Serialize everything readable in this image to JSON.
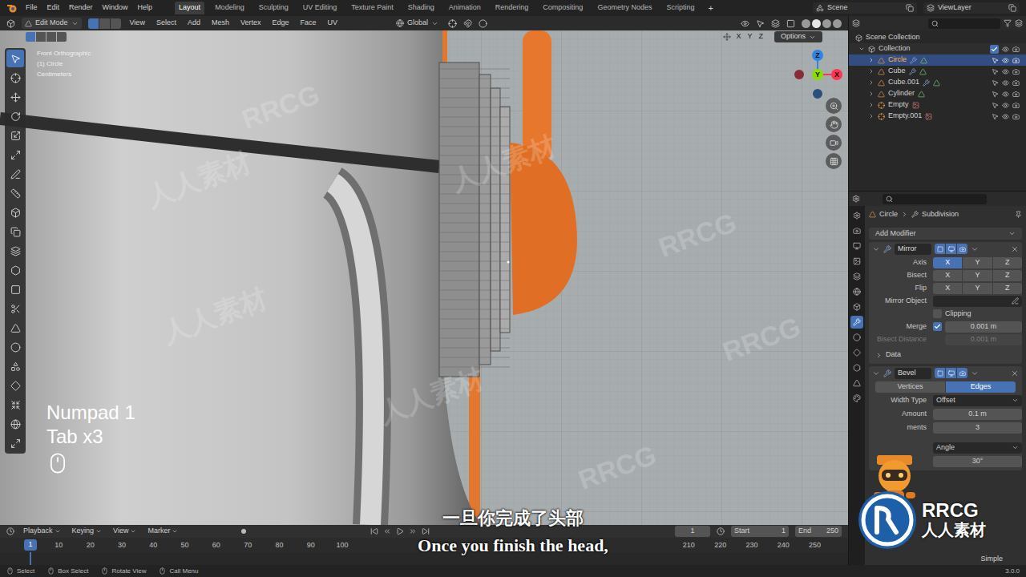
{
  "top_bar": {
    "menus": [
      "File",
      "Edit",
      "Render",
      "Window",
      "Help"
    ],
    "workspaces": [
      {
        "label": "Layout",
        "selected": true
      },
      {
        "label": "Modeling",
        "selected": false
      },
      {
        "label": "Sculpting",
        "selected": false
      },
      {
        "label": "UV Editing",
        "selected": false
      },
      {
        "label": "Texture Paint",
        "selected": false
      },
      {
        "label": "Shading",
        "selected": false
      },
      {
        "label": "Animation",
        "selected": false
      },
      {
        "label": "Rendering",
        "selected": false
      },
      {
        "label": "Compositing",
        "selected": false
      },
      {
        "label": "Geometry Nodes",
        "selected": false
      },
      {
        "label": "Scripting",
        "selected": false
      }
    ],
    "add_workspace": "+",
    "scene": "Scene",
    "view_layer": "ViewLayer"
  },
  "viewport_header": {
    "mode": "Edit Mode",
    "menus": [
      "View",
      "Select",
      "Add",
      "Mesh",
      "Vertex",
      "Edge",
      "Face",
      "UV"
    ],
    "orientation": "Global",
    "axes": [
      "X",
      "Y",
      "Z"
    ],
    "options": "Options"
  },
  "viewport": {
    "view": "Front Orthographic",
    "object": "(1) Circle",
    "units": "Centimeters",
    "keys": [
      "Numpad 1",
      "Tab x3"
    ],
    "gizmo": [
      {
        "label": "Z",
        "color": "#2f83e3"
      },
      {
        "label": "Y",
        "color": "#8bdc00"
      },
      {
        "label": "X",
        "color": "#ff3352"
      }
    ]
  },
  "watermarks": [
    "RRCG",
    "人人素材"
  ],
  "outliner": {
    "root": "Scene Collection",
    "collection": "Collection",
    "collection_checked": true,
    "items": [
      {
        "name": "Circle",
        "selected": true,
        "kind": "mesh",
        "modified": true
      },
      {
        "name": "Cube",
        "selected": false,
        "kind": "mesh",
        "modified": true
      },
      {
        "name": "Cube.001",
        "selected": false,
        "kind": "mesh",
        "modified": true
      },
      {
        "name": "Cylinder",
        "selected": false,
        "kind": "mesh",
        "modified": false
      },
      {
        "name": "Empty",
        "selected": false,
        "kind": "empty",
        "modified": false
      },
      {
        "name": "Empty.001",
        "selected": false,
        "kind": "empty",
        "modified": false
      }
    ]
  },
  "properties": {
    "breadcrumb": [
      "Circle",
      "Subdivision"
    ],
    "add_modifier": "Add Modifier",
    "mirror": {
      "name": "Mirror",
      "toggle_rows": [
        {
          "label": "Axis",
          "buttons": [
            {
              "label": "X",
              "selected": true
            },
            {
              "label": "Y",
              "selected": false
            },
            {
              "label": "Z",
              "selected": false
            }
          ]
        },
        {
          "label": "Bisect",
          "buttons": [
            {
              "label": "X",
              "selected": false
            },
            {
              "label": "Y",
              "selected": false
            },
            {
              "label": "Z",
              "selected": false
            }
          ]
        },
        {
          "label": "Flip",
          "buttons": [
            {
              "label": "X",
              "selected": false
            },
            {
              "label": "Y",
              "selected": false
            },
            {
              "label": "Z",
              "selected": false
            }
          ]
        }
      ],
      "mirror_object_label": "Mirror Object",
      "clipping": {
        "label": "Clipping",
        "checked": false
      },
      "merge": {
        "label": "Merge",
        "checked": true,
        "value": "0.001 m"
      },
      "bisect_distance": {
        "label": "Bisect Distance",
        "value": "0.001 m",
        "disabled": true
      },
      "data": "Data"
    },
    "bevel": {
      "name": "Bevel",
      "tabs": [
        {
          "label": "Vertices",
          "selected": false
        },
        {
          "label": "Edges",
          "selected": true
        }
      ],
      "rows": [
        {
          "label": "Width Type",
          "value": "Offset",
          "kind": "dropdown"
        },
        {
          "label": "Amount",
          "value": "0.1 m",
          "kind": "number"
        },
        {
          "label": "ments",
          "value": "3",
          "kind": "number"
        },
        {
          "label": "",
          "value": "Angle",
          "kind": "dropdown"
        },
        {
          "label": "",
          "value": "30°",
          "kind": "number"
        }
      ]
    },
    "footer_value": "Simple"
  },
  "timeline": {
    "menus": [
      "Playback",
      "Keying",
      "View",
      "Marker"
    ],
    "frame": "1",
    "start_label": "Start",
    "start": "1",
    "end_label": "End",
    "end": "250",
    "playhead": "1",
    "ticks": [
      "10",
      "20",
      "30",
      "40",
      "50",
      "60",
      "70",
      "80",
      "90",
      "100",
      "210",
      "220",
      "230",
      "240",
      "250"
    ]
  },
  "status_bar": {
    "items": [
      "Select",
      "Box Select",
      "Rotate View",
      "Call Menu"
    ],
    "version": "3.0.0"
  },
  "subtitles": {
    "zh": "一旦你完成了头部",
    "en": "Once you finish the head,"
  },
  "brand": {
    "logo": "RRCG",
    "name": "人人素材"
  }
}
